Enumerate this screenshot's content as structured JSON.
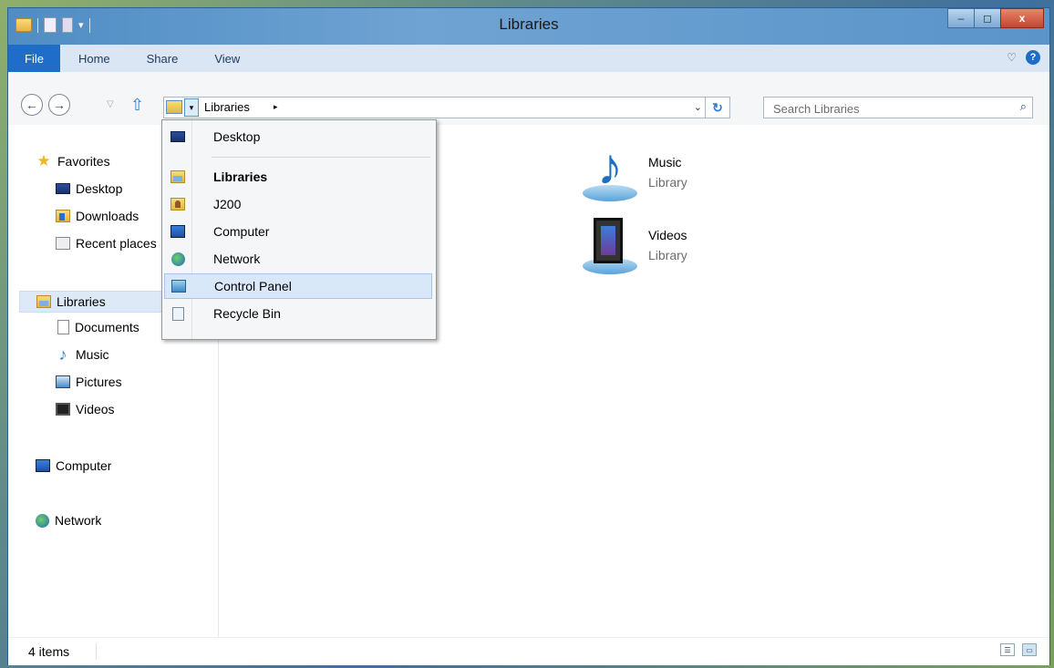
{
  "window": {
    "title": "Libraries",
    "min_label": "–",
    "max_label": "◻",
    "close_label": "x"
  },
  "ribbon": {
    "tabs": [
      {
        "label": "File"
      },
      {
        "label": "Home"
      },
      {
        "label": "Share"
      },
      {
        "label": "View"
      }
    ],
    "expand_icon": "chevron-down-icon",
    "help_label": "?"
  },
  "navbar": {
    "back_glyph": "←",
    "forward_glyph": "→",
    "recent_glyph": "▽",
    "up_glyph": "⇧",
    "address": {
      "path": "Libraries",
      "arrow": "▸",
      "dropdown_glyph": "▾",
      "history_glyph": "⌄",
      "refresh_glyph": "↻"
    },
    "search": {
      "placeholder": "Search Libraries",
      "icon_glyph": "⌕"
    }
  },
  "navpane": {
    "favorites": {
      "label": "Favorites"
    },
    "desktop": {
      "label": "Desktop"
    },
    "downloads": {
      "label": "Downloads"
    },
    "recent": {
      "label": "Recent places"
    },
    "libraries": {
      "label": "Libraries"
    },
    "documents": {
      "label": "Documents"
    },
    "music": {
      "label": "Music"
    },
    "pictures": {
      "label": "Pictures"
    },
    "videos": {
      "label": "Videos"
    },
    "computer": {
      "label": "Computer"
    },
    "network": {
      "label": "Network"
    }
  },
  "main": {
    "items": [
      {
        "name": "Music",
        "type": "Library"
      },
      {
        "name": "Videos",
        "type": "Library"
      }
    ]
  },
  "dropdown": {
    "items": [
      {
        "label": "Desktop",
        "icon": "desktop-icon"
      },
      {
        "label": "Libraries",
        "icon": "libraries-icon",
        "bold": true
      },
      {
        "label": "J200",
        "icon": "user-folder-icon"
      },
      {
        "label": "Computer",
        "icon": "computer-icon"
      },
      {
        "label": "Network",
        "icon": "network-icon"
      },
      {
        "label": "Control Panel",
        "icon": "control-panel-icon",
        "highlighted": true
      },
      {
        "label": "Recycle Bin",
        "icon": "recycle-bin-icon"
      }
    ]
  },
  "status": {
    "item_count": "4 items"
  },
  "colors": {
    "file_tab": "#1e6ec9",
    "ribbon_tabs_bg": "#dbe6f4",
    "selection": "#dde9f7",
    "highlight": "#d9e8f9",
    "close_button": "#c7432c"
  }
}
